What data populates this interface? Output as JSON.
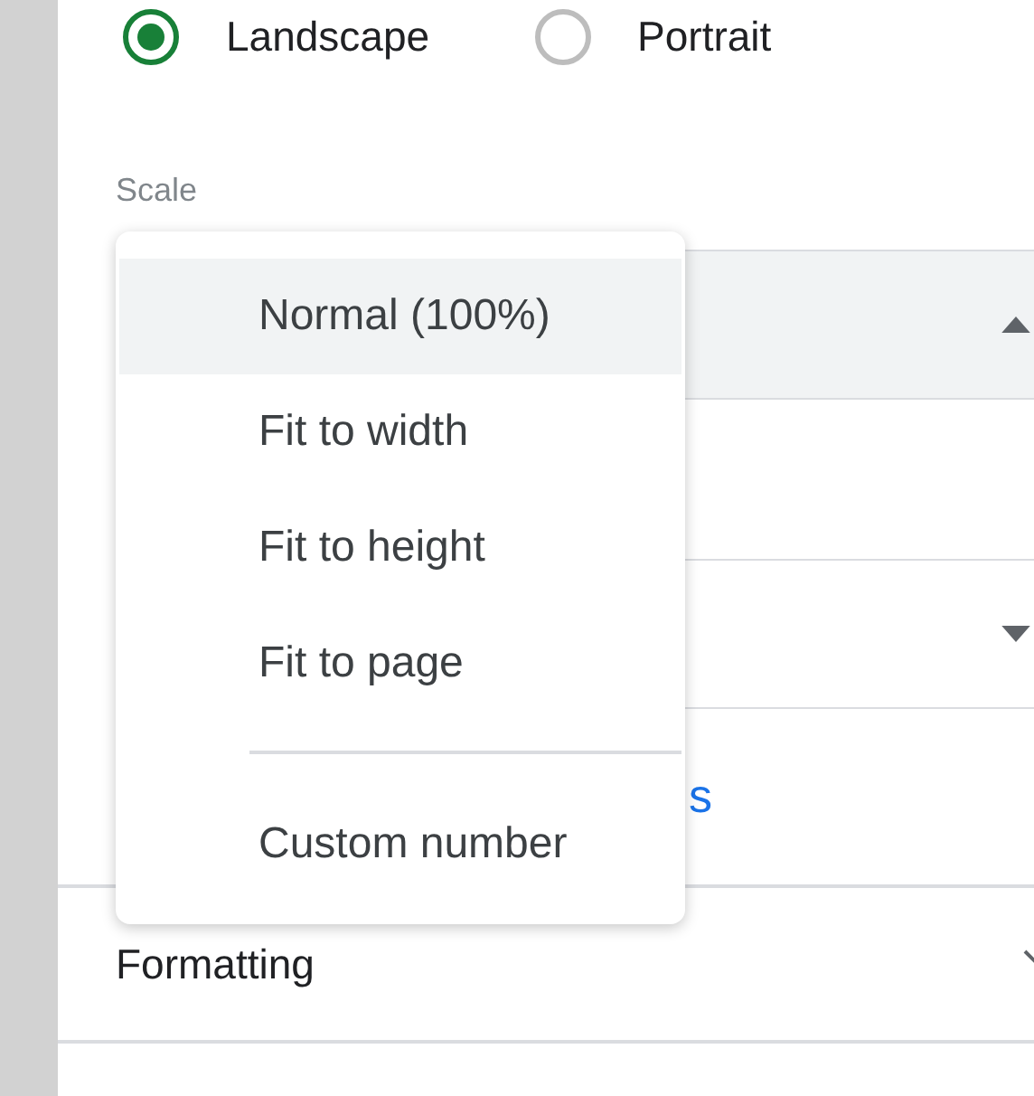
{
  "orientation": [
    {
      "label": "Landscape",
      "selected": true
    },
    {
      "label": "Portrait",
      "selected": false
    }
  ],
  "scale": {
    "label": "Scale",
    "open": true
  },
  "second_select": {
    "open": false
  },
  "link": {
    "text": "s"
  },
  "section": {
    "title": "Formatting",
    "expanded": false
  },
  "menu": {
    "items": [
      {
        "label": "Normal (100%)",
        "selected": true,
        "divider_above": false
      },
      {
        "label": "Fit to width",
        "selected": false,
        "divider_above": false
      },
      {
        "label": "Fit to height",
        "selected": false,
        "divider_above": false
      },
      {
        "label": "Fit to page",
        "selected": false,
        "divider_above": false
      },
      {
        "label": "Custom number",
        "selected": false,
        "divider_above": true
      }
    ]
  }
}
